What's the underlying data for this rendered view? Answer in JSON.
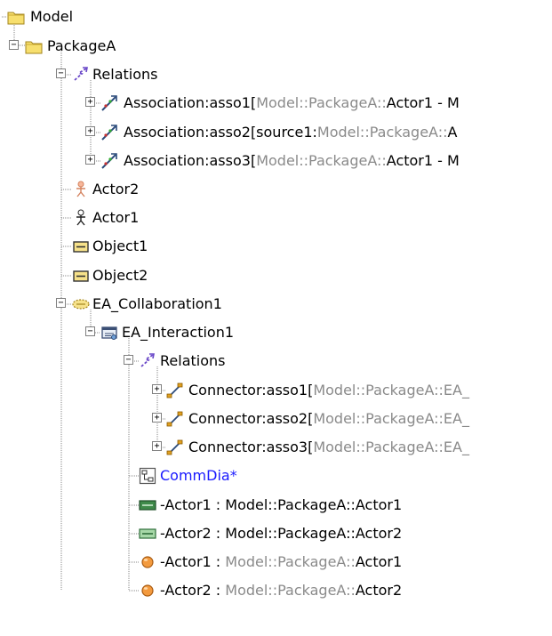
{
  "tree": {
    "rows": [
      {
        "name": "model-node",
        "icon": "folder-icon",
        "toggle": "",
        "parts": [
          {
            "t": "Model",
            "c": "n"
          }
        ]
      },
      {
        "name": "packagea-node",
        "icon": "folder-icon",
        "toggle": "−",
        "parts": [
          {
            "t": "PackageA",
            "c": "n"
          }
        ]
      },
      {
        "name": "relations-node",
        "icon": "relations-icon",
        "toggle": "−",
        "parts": [
          {
            "t": "Relations",
            "c": "n"
          }
        ]
      },
      {
        "name": "association-asso1-node",
        "icon": "association-icon",
        "toggle": "+",
        "parts": [
          {
            "t": "Association:asso1[",
            "c": "n"
          },
          {
            "t": "Model::PackageA::",
            "c": "g"
          },
          {
            "t": "Actor1 - M",
            "c": "n"
          }
        ]
      },
      {
        "name": "association-asso2-node",
        "icon": "association-icon",
        "toggle": "+",
        "parts": [
          {
            "t": "Association:asso2[source1:",
            "c": "n"
          },
          {
            "t": "Model::PackageA::",
            "c": "g"
          },
          {
            "t": "A",
            "c": "n"
          }
        ]
      },
      {
        "name": "association-asso3-node",
        "icon": "association-icon",
        "toggle": "+",
        "parts": [
          {
            "t": "Association:asso3[",
            "c": "n"
          },
          {
            "t": "Model::PackageA::",
            "c": "g"
          },
          {
            "t": "Actor1 - M",
            "c": "n"
          }
        ]
      },
      {
        "name": "actor2-node",
        "icon": "actor-orange-icon",
        "toggle": "",
        "parts": [
          {
            "t": "Actor2",
            "c": "n"
          }
        ]
      },
      {
        "name": "actor1-node",
        "icon": "actor-icon",
        "toggle": "",
        "parts": [
          {
            "t": "Actor1",
            "c": "n"
          }
        ]
      },
      {
        "name": "object1-node",
        "icon": "object-icon",
        "toggle": "",
        "parts": [
          {
            "t": "Object1",
            "c": "n"
          }
        ]
      },
      {
        "name": "object2-node",
        "icon": "object-icon",
        "toggle": "",
        "parts": [
          {
            "t": "Object2",
            "c": "n"
          }
        ]
      },
      {
        "name": "ea-collaboration1-node",
        "icon": "collaboration-icon",
        "toggle": "−",
        "parts": [
          {
            "t": "EA_Collaboration1",
            "c": "n"
          }
        ]
      },
      {
        "name": "ea-interaction1-node",
        "icon": "interaction-icon",
        "toggle": "−",
        "parts": [
          {
            "t": "EA_Interaction1",
            "c": "n"
          }
        ]
      },
      {
        "name": "relations-node-2",
        "icon": "relations-icon",
        "toggle": "−",
        "parts": [
          {
            "t": "Relations",
            "c": "n"
          }
        ]
      },
      {
        "name": "connector-asso1-node",
        "icon": "connector-icon",
        "toggle": "+",
        "parts": [
          {
            "t": "Connector:asso1[",
            "c": "n"
          },
          {
            "t": "Model::PackageA::EA_",
            "c": "g"
          }
        ]
      },
      {
        "name": "connector-asso2-node",
        "icon": "connector-icon",
        "toggle": "+",
        "parts": [
          {
            "t": "Connector:asso2[",
            "c": "n"
          },
          {
            "t": "Model::PackageA::EA_",
            "c": "g"
          }
        ]
      },
      {
        "name": "connector-asso3-node",
        "icon": "connector-icon",
        "toggle": "+",
        "parts": [
          {
            "t": "Connector:asso3[",
            "c": "n"
          },
          {
            "t": "Model::PackageA::EA_",
            "c": "g"
          }
        ]
      },
      {
        "name": "commdia-node",
        "icon": "diagram-icon",
        "toggle": "",
        "parts": [
          {
            "t": "CommDia*",
            "c": "b"
          }
        ]
      },
      {
        "name": "actor1-part-node",
        "icon": "part-dark-icon",
        "toggle": "",
        "parts": [
          {
            "t": "-Actor1 : Model::PackageA::Actor1",
            "c": "n"
          }
        ]
      },
      {
        "name": "actor2-part-node",
        "icon": "part-light-icon",
        "toggle": "",
        "parts": [
          {
            "t": "-Actor2 : Model::PackageA::Actor2",
            "c": "n"
          }
        ]
      },
      {
        "name": "actor1-lifeline-node",
        "icon": "lifeline-icon",
        "toggle": "",
        "parts": [
          {
            "t": "-Actor1 : ",
            "c": "n"
          },
          {
            "t": "Model::PackageA::",
            "c": "g"
          },
          {
            "t": "Actor1",
            "c": "n"
          }
        ]
      },
      {
        "name": "actor2-lifeline-node",
        "icon": "lifeline-icon",
        "toggle": "",
        "parts": [
          {
            "t": "-Actor2 : ",
            "c": "n"
          },
          {
            "t": "Model::PackageA::",
            "c": "g"
          },
          {
            "t": "Actor2",
            "c": "n"
          }
        ]
      }
    ]
  }
}
